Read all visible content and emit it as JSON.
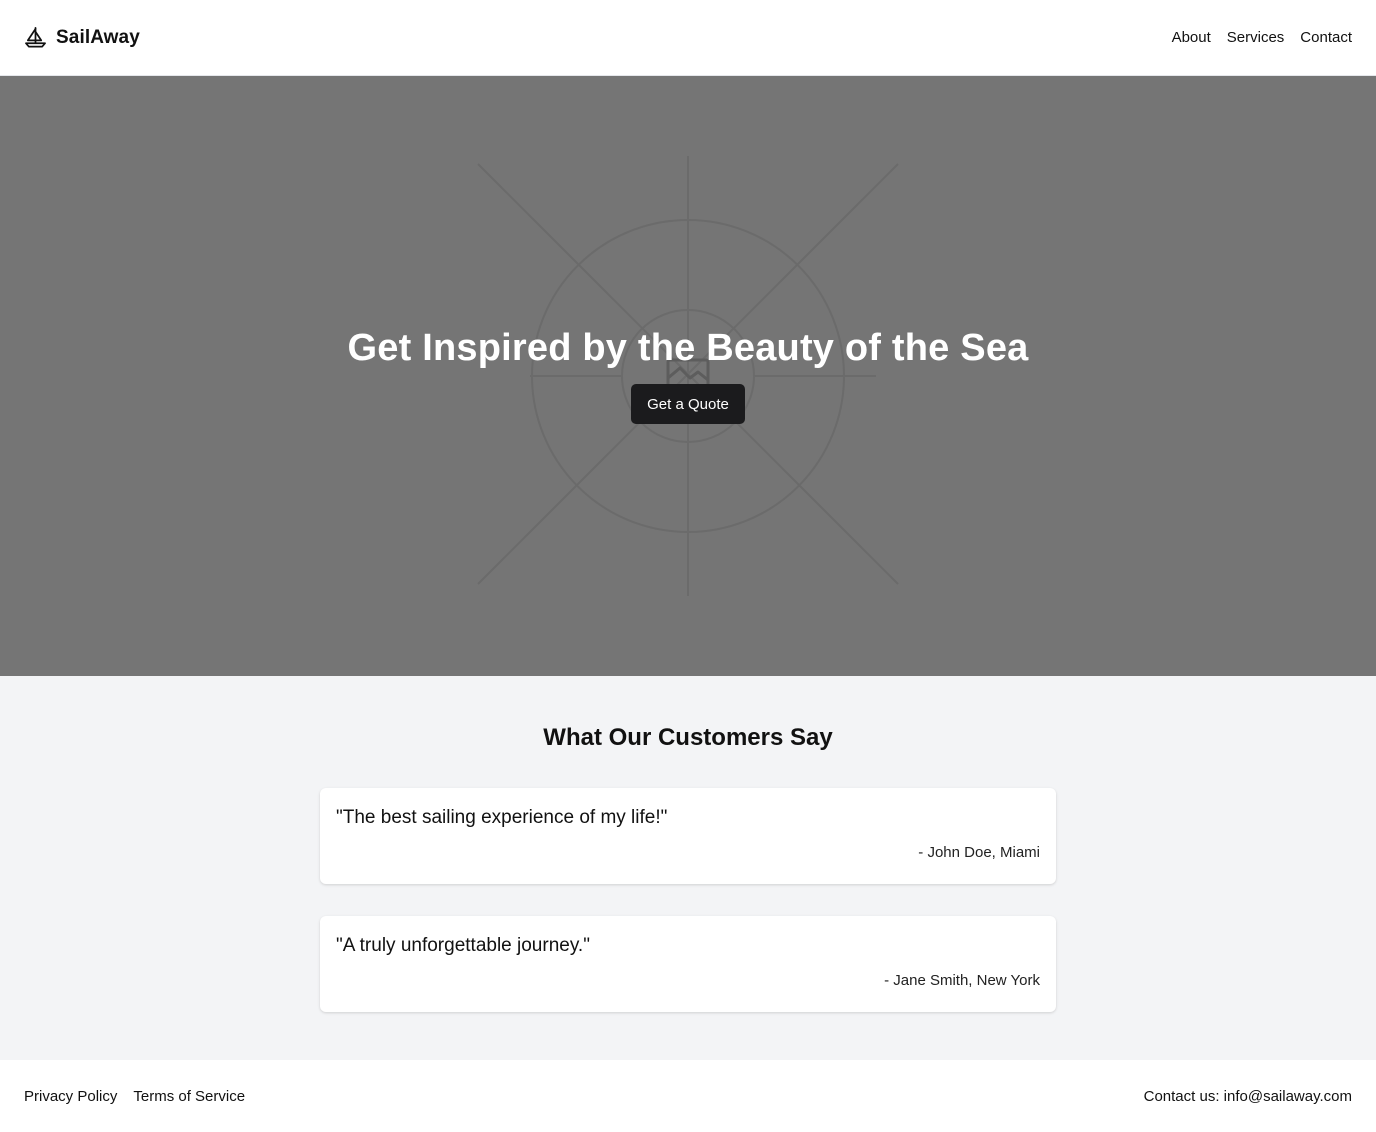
{
  "header": {
    "brand_name": "SailAway",
    "brand_icon": "sailboat-icon",
    "nav": [
      {
        "label": "About"
      },
      {
        "label": "Services"
      },
      {
        "label": "Contact"
      }
    ]
  },
  "hero": {
    "title": "Get Inspired by the Beauty of the Sea",
    "cta_label": "Get a Quote",
    "background_color": "#757575",
    "background_icon": "image-placeholder-icon"
  },
  "testimonials": {
    "title": "What Our Customers Say",
    "items": [
      {
        "quote": "\"The best sailing experience of my life!\"",
        "author": "- John Doe, Miami"
      },
      {
        "quote": "\"A truly unforgettable journey.\"",
        "author": "- Jane Smith, New York"
      }
    ]
  },
  "footer": {
    "links": [
      {
        "label": "Privacy Policy"
      },
      {
        "label": "Terms of Service"
      }
    ],
    "contact": "Contact us: info@sailaway.com"
  },
  "colors": {
    "button_bg": "#1b1b1d",
    "section_bg": "#f3f4f6"
  }
}
